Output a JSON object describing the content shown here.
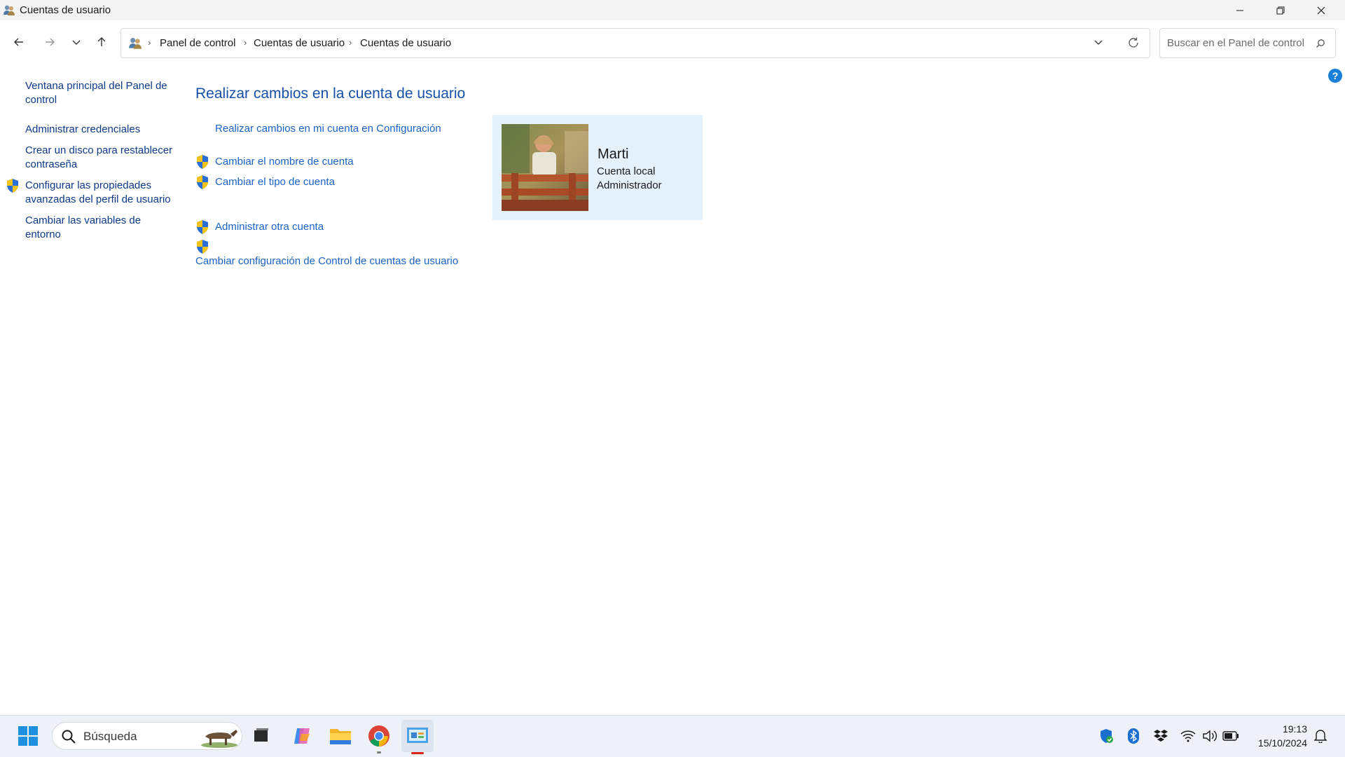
{
  "window": {
    "title": "Cuentas de usuario"
  },
  "address": {
    "crumbs": [
      "Panel de control",
      "Cuentas de usuario",
      "Cuentas de usuario"
    ]
  },
  "search": {
    "placeholder": "Buscar en el Panel de control"
  },
  "help": {
    "label": "?"
  },
  "sidebar": {
    "items": [
      {
        "label": "Ventana principal del Panel de control"
      },
      {
        "label": "Administrar credenciales"
      },
      {
        "label": "Crear un disco para restablecer contraseña"
      },
      {
        "label": "Configurar las propiedades avanzadas del perfil de usuario",
        "shield": true
      },
      {
        "label": "Cambiar las variables de entorno"
      }
    ]
  },
  "main": {
    "title": "Realizar cambios en la cuenta de usuario",
    "links": [
      {
        "label": "Realizar cambios en mi cuenta en Configuración"
      },
      {
        "label": "Cambiar el nombre de cuenta",
        "shield": true
      },
      {
        "label": "Cambiar el tipo de cuenta",
        "shield": true
      },
      {
        "label": "Administrar otra cuenta",
        "shield": true
      },
      {
        "label": "Cambiar configuración de Control de cuentas de usuario",
        "shield": true
      }
    ]
  },
  "user": {
    "name": "Marti",
    "account_type": "Cuenta local",
    "role": "Administrador"
  },
  "taskbar": {
    "search_text": "Búsqueda",
    "apps": [
      "task-view-icon",
      "copilot-icon",
      "file-explorer-icon",
      "chrome-icon",
      "control-panel-icon"
    ],
    "tray": [
      "windows-security-icon",
      "bluetooth-icon",
      "dropbox-icon",
      "wifi-icon",
      "volume-icon",
      "battery-icon"
    ]
  },
  "clock": {
    "time": "19:13",
    "date": "15/10/2024"
  },
  "colors": {
    "link": "#1a62c5",
    "sidebar_link": "#0d3a8a",
    "title": "#1650a8",
    "card_bg": "#e5f1fb"
  }
}
